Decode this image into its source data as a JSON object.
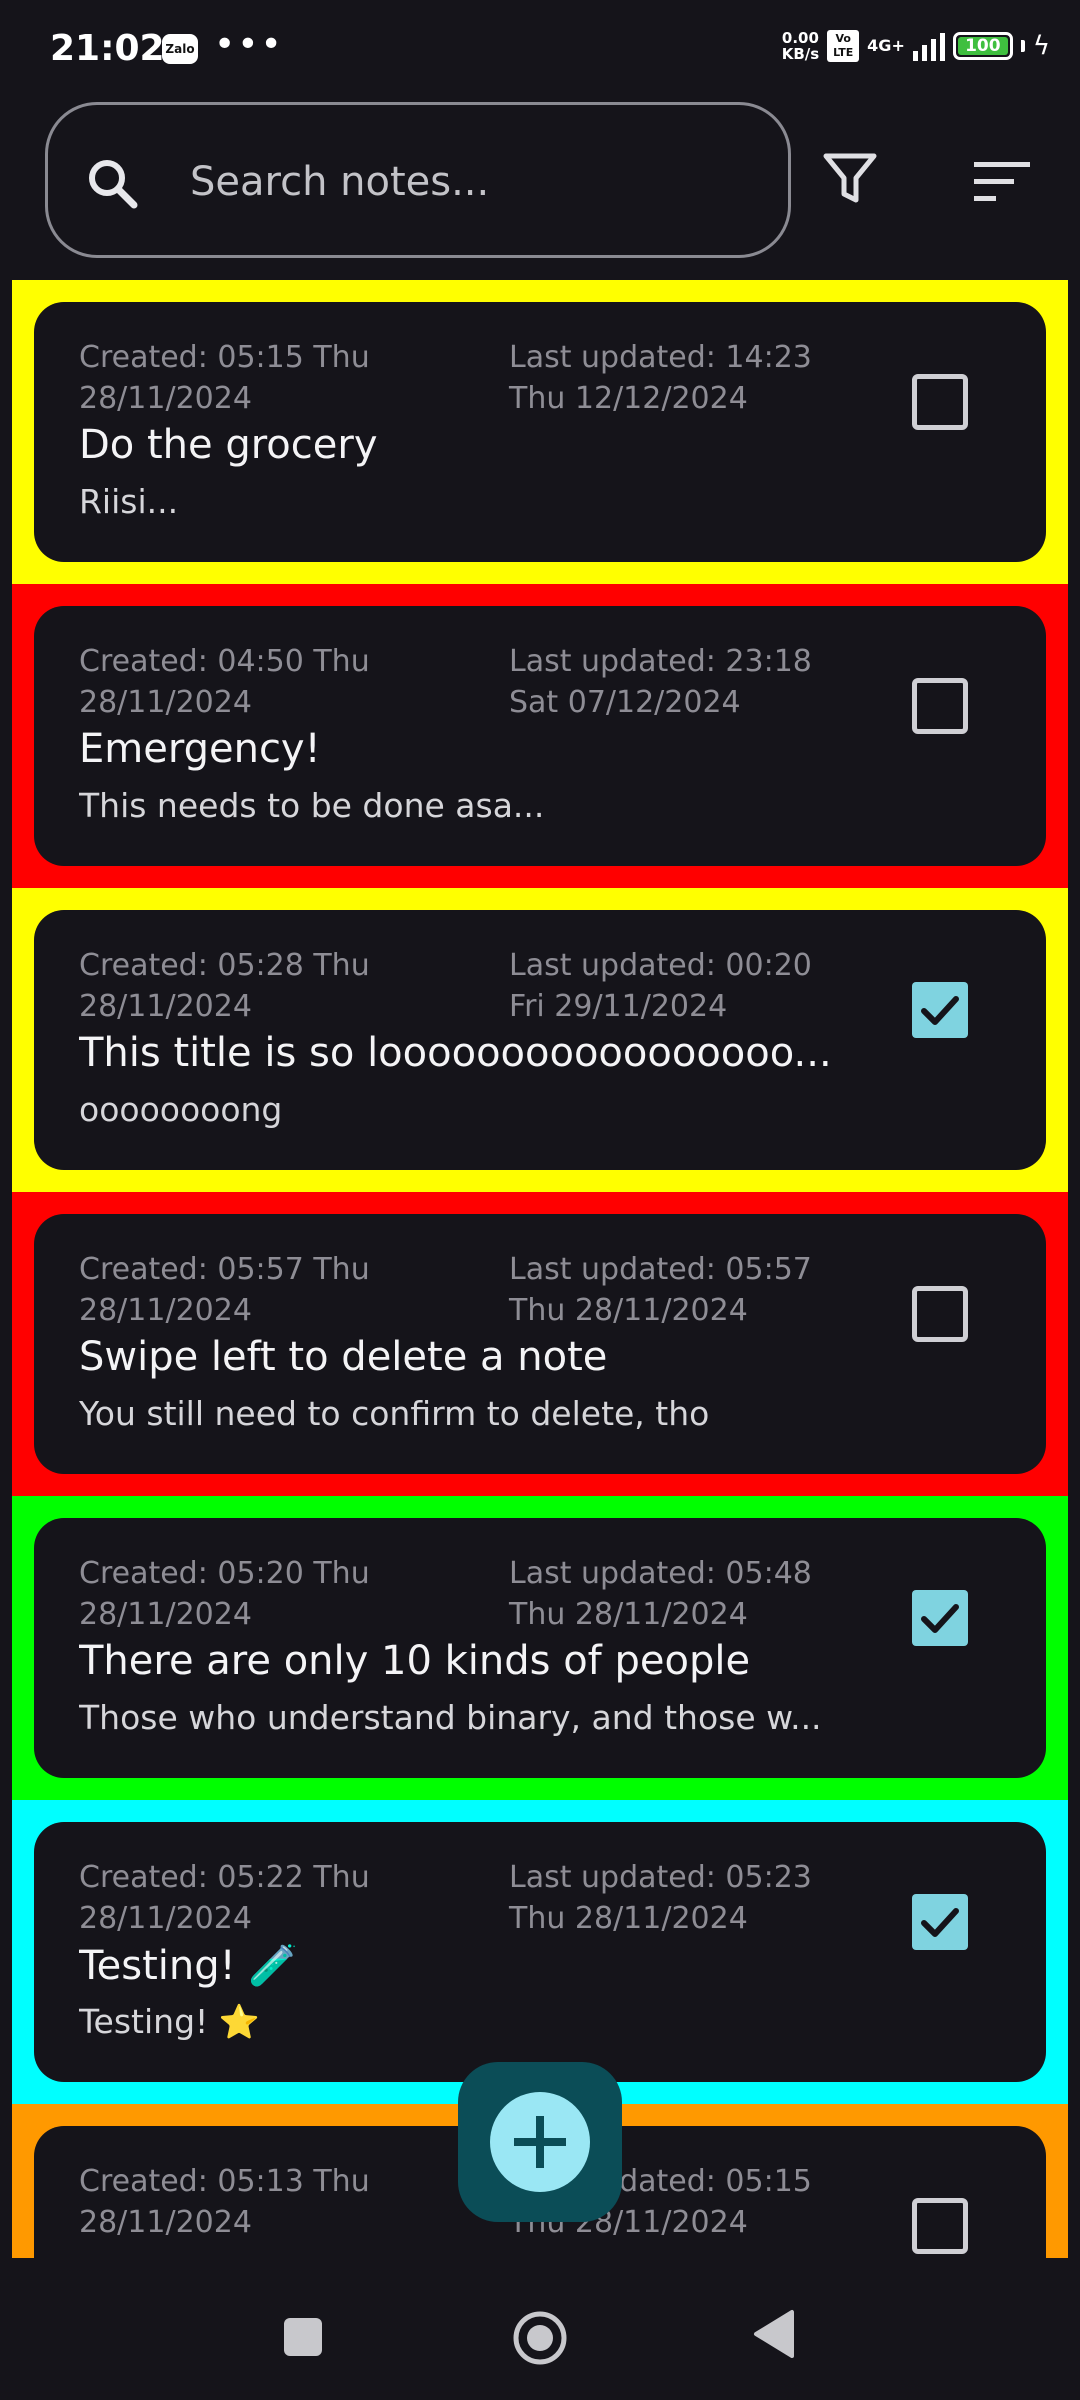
{
  "status_bar": {
    "time": "21:02",
    "zalo_label": "Zalo",
    "more": "•••",
    "speed_value": "0.00",
    "speed_unit": "KB/s",
    "volte": "Vo LTE",
    "network": "4G+",
    "battery": "100",
    "icons": [
      "zalo-icon",
      "more-icon",
      "volte-icon",
      "signal-icon",
      "battery-icon",
      "charging-icon"
    ]
  },
  "search": {
    "placeholder": "Search notes..."
  },
  "toolbar": {
    "filter_icon": "filter-icon",
    "sort_icon": "sort-icon"
  },
  "colors": {
    "background": "#15141a",
    "yellow": "#ffff00",
    "red": "#ff0000",
    "green": "#00ff00",
    "cyan": "#00ffff",
    "orange": "#ff9900",
    "checkbox_checked": "#7fd3e0",
    "fab_bg": "#0b4d57",
    "fab_circle": "#9ae7f4"
  },
  "notes": [
    {
      "color": "#ffff00",
      "created": "Created: 05:15 Thu",
      "created_date": "28/11/2024",
      "updated": "Last updated: 14:23",
      "updated_date": "Thu 12/12/2024",
      "title": "Do the grocery",
      "body": "Riisi...",
      "checked": false
    },
    {
      "color": "#ff0000",
      "created": "Created: 04:50 Thu",
      "created_date": "28/11/2024",
      "updated": "Last updated: 23:18",
      "updated_date": "Sat 07/12/2024",
      "title": "Emergency!",
      "body": "This needs to be done asa...",
      "checked": false
    },
    {
      "color": "#ffff00",
      "created": "Created: 05:28 Thu",
      "created_date": "28/11/2024",
      "updated": "Last updated: 00:20",
      "updated_date": "Fri 29/11/2024",
      "title": "This title is so looooooooooooooooo...",
      "body": "oooooooong",
      "checked": true
    },
    {
      "color": "#ff0000",
      "created": "Created: 05:57 Thu",
      "created_date": "28/11/2024",
      "updated": "Last updated: 05:57",
      "updated_date": "Thu 28/11/2024",
      "title": "Swipe left to delete a note",
      "body": "You still need to confirm to delete, tho",
      "checked": false
    },
    {
      "color": "#00ff00",
      "created": "Created: 05:20 Thu",
      "created_date": "28/11/2024",
      "updated": "Last updated: 05:48",
      "updated_date": "Thu 28/11/2024",
      "title": "There are only 10 kinds of people",
      "body": "Those who understand binary, and those w...",
      "checked": true
    },
    {
      "color": "#00ffff",
      "created": "Created: 05:22 Thu",
      "created_date": "28/11/2024",
      "updated": "Last updated: 05:23",
      "updated_date": "Thu 28/11/2024",
      "title": "Testing! 🧪",
      "body": "Testing! ⭐",
      "checked": true
    },
    {
      "color": "#ff9900",
      "created": "Created: 05:13 Thu",
      "created_date": "28/11/2024",
      "updated": "Last updated: 05:15",
      "updated_date": "Thu 28/11/2024",
      "title": "",
      "body": "",
      "checked": false
    }
  ],
  "fab": {
    "icon": "plus-icon"
  },
  "navigation": {
    "recents_icon": "recents-icon",
    "home_icon": "home-icon",
    "back_icon": "back-icon"
  }
}
